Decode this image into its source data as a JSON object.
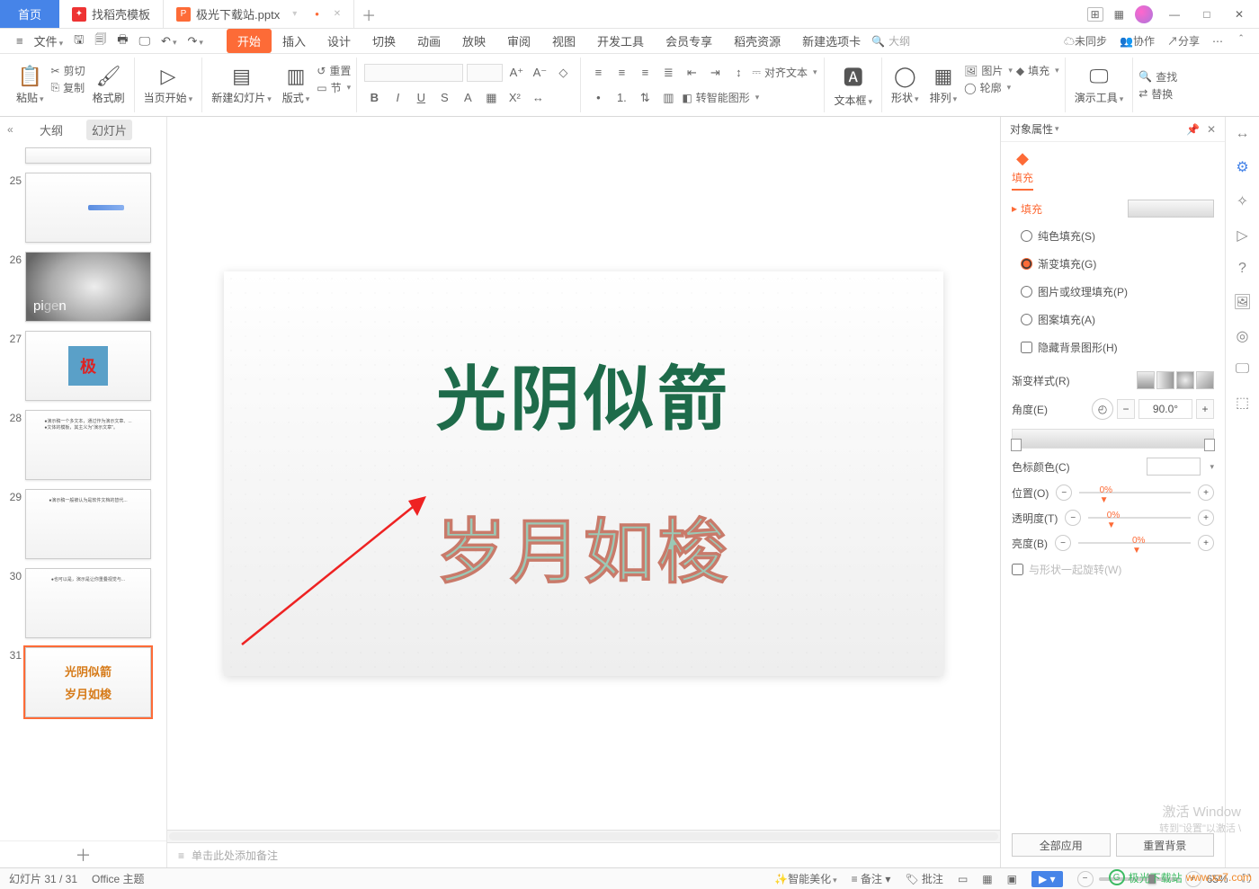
{
  "tabs": {
    "home": "首页",
    "search_templates": "找稻壳模板",
    "doc_name": "极光下载站.pptx"
  },
  "window": {
    "layout_icon": "⊞",
    "grid_icon": "▦"
  },
  "quickaccess": {
    "file_menu": "文件"
  },
  "menu": {
    "items": [
      "开始",
      "插入",
      "设计",
      "切换",
      "动画",
      "放映",
      "审阅",
      "视图",
      "开发工具",
      "会员专享",
      "稻壳资源",
      "新建选项卡"
    ],
    "search_placeholder": "大纲",
    "right": {
      "unsync": "未同步",
      "collab": "协作",
      "share": "分享"
    }
  },
  "ribbon": {
    "paste": "粘贴",
    "cut": "剪切",
    "copy": "复制",
    "format_painter": "格式刷",
    "from_current": "当页开始",
    "new_slide": "新建幻灯片",
    "layout": "版式",
    "section": "节",
    "reset": "重置",
    "font_name": "",
    "font_size": "",
    "align_text": "对齐文本",
    "smart_shape": "转智能图形",
    "textbox": "文本框",
    "shape": "形状",
    "arrange": "排列",
    "image": "图片",
    "fill": "填充",
    "outline": "轮廓",
    "present_tools": "演示工具",
    "find": "查找",
    "replace": "替换"
  },
  "sidebar": {
    "tabs": {
      "outline": "大纲",
      "slides": "幻灯片"
    },
    "thumbs": [
      {
        "num": "",
        "content": ""
      },
      {
        "num": "25",
        "content": ""
      },
      {
        "num": "26",
        "content": "pigeon"
      },
      {
        "num": "27",
        "content": "极"
      },
      {
        "num": "28",
        "content": "text"
      },
      {
        "num": "29",
        "content": "text"
      },
      {
        "num": "30",
        "content": "text"
      },
      {
        "num": "31",
        "line1": "光阴似箭",
        "line2": "岁月如梭",
        "selected": true
      }
    ]
  },
  "slide": {
    "text1": "光阴似箭",
    "text2": "岁月如梭"
  },
  "notes": {
    "placeholder": "单击此处添加备注"
  },
  "props": {
    "title": "对象属性",
    "fill_tab": "填充",
    "section": "填充",
    "radios": {
      "solid": "纯色填充(S)",
      "gradient": "渐变填充(G)",
      "picture": "图片或纹理填充(P)",
      "pattern": "图案填充(A)",
      "hide_bg": "隐藏背景图形(H)"
    },
    "gradient_style": "渐变样式(R)",
    "angle": "角度(E)",
    "angle_value": "90.0°",
    "stop_color": "色标颜色(C)",
    "position": "位置(O)",
    "position_value": "0%",
    "transparency": "透明度(T)",
    "transparency_value": "0%",
    "brightness": "亮度(B)",
    "brightness_value": "0%",
    "rotate_with_shape": "与形状一起旋转(W)",
    "apply_all": "全部应用",
    "reset_bg": "重置背景"
  },
  "status": {
    "slide_counter": "幻灯片 31 / 31",
    "theme": "Office 主题",
    "smart_beautify": "智能美化",
    "notes_btn": "备注",
    "comments_btn": "批注",
    "zoom": "65%"
  },
  "watermark": {
    "line1": "激活 Window",
    "line2": "转到\"设置\"以激活 \\"
  },
  "brand": {
    "name": "极光下载站",
    "url": "www.xz7.com"
  }
}
